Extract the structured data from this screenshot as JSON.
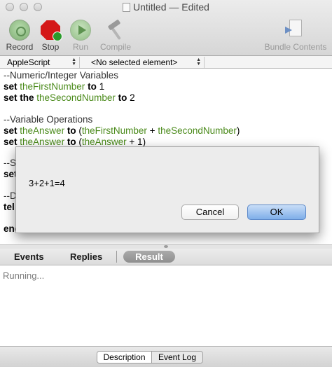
{
  "window": {
    "title": "Untitled — Edited"
  },
  "toolbar": {
    "record_label": "Record",
    "stop_label": "Stop",
    "run_label": "Run",
    "compile_label": "Compile",
    "bundle_label": "Bundle Contents"
  },
  "navbar": {
    "language": "AppleScript",
    "element": "<No selected element>"
  },
  "editor": {
    "line1": "--Numeric/Integer Variables",
    "line2": {
      "kw1": "set",
      "var": "theFirstNumber",
      "kw2": "to",
      "val": "1"
    },
    "line3": {
      "kw1": "set the",
      "var": "theSecondNumber",
      "kw2": "to",
      "val": "2"
    },
    "line5": "--Variable Operations",
    "line6": {
      "kw1": "set",
      "var1": "theAnswer",
      "kw2": "to",
      "open": "(",
      "var2": "theFirstNumber",
      "op": "+",
      "var3": "theSecondNumber",
      "close": ")"
    },
    "line7": {
      "kw1": "set",
      "var1": "theAnswer",
      "kw2": "to",
      "open": "(",
      "var2": "theAnswer",
      "op": "+ 1)"
    },
    "partial_a": "--S",
    "partial_b": "set",
    "partial_c": "--D",
    "partial_d": "tel",
    "partial_e": "end"
  },
  "dialog": {
    "message": "3+2+1=4",
    "cancel_label": "Cancel",
    "ok_label": "OK"
  },
  "tabs": {
    "events": "Events",
    "replies": "Replies",
    "result": "Result"
  },
  "result": {
    "status": "Running..."
  },
  "bottom": {
    "description": "Description",
    "event_log": "Event Log"
  },
  "colors": {
    "variable_green": "#4a8a1a",
    "ok_button_blue": "#7eaee9",
    "stop_red": "#d41818"
  }
}
